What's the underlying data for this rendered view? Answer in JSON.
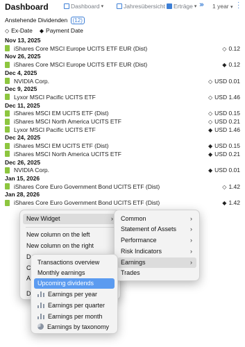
{
  "header": {
    "title": "Dashboard",
    "crumbs": [
      "Dashboard",
      "Jahresübersicht",
      "Erträge"
    ],
    "period": "1 year"
  },
  "section": {
    "title": "Anstehende Dividenden",
    "count": "(12)"
  },
  "legend": {
    "ex_date": "Ex-Date",
    "payment_date": "Payment Date",
    "ex_symbol": "◇",
    "pay_symbol": "◆"
  },
  "dividends": [
    {
      "date": "Nov 13, 2025",
      "items": [
        {
          "name": "iShares Core MSCI Europe UCITS ETF EUR (Dist)",
          "marker": "◇",
          "amount": "0.12"
        }
      ]
    },
    {
      "date": "Nov 26, 2025",
      "items": [
        {
          "name": "iShares Core MSCI Europe UCITS ETF EUR (Dist)",
          "marker": "◆",
          "amount": "0.12"
        }
      ]
    },
    {
      "date": "Dec 4, 2025",
      "items": [
        {
          "name": "NVIDIA Corp.",
          "marker": "◇",
          "amount": "USD 0.01"
        }
      ]
    },
    {
      "date": "Dec 9, 2025",
      "items": [
        {
          "name": "Lyxor MSCI Pacific UCITS ETF",
          "marker": "◇",
          "amount": "USD 1.46"
        }
      ]
    },
    {
      "date": "Dec 11, 2025",
      "items": [
        {
          "name": "iShares MSCI EM UCITS ETF (Dist)",
          "marker": "◇",
          "amount": "USD 0.15"
        },
        {
          "name": "iShares MSCI North America UCITS ETF",
          "marker": "◇",
          "amount": "USD 0.21"
        },
        {
          "name": "Lyxor MSCI Pacific UCITS ETF",
          "marker": "◆",
          "amount": "USD 1.46"
        }
      ]
    },
    {
      "date": "Dec 24, 2025",
      "items": [
        {
          "name": "iShares MSCI EM UCITS ETF (Dist)",
          "marker": "◆",
          "amount": "USD 0.15"
        },
        {
          "name": "iShares MSCI North America UCITS ETF",
          "marker": "◆",
          "amount": "USD 0.21"
        }
      ]
    },
    {
      "date": "Dec 26, 2025",
      "items": [
        {
          "name": "NVIDIA Corp.",
          "marker": "◆",
          "amount": "USD 0.01"
        }
      ]
    },
    {
      "date": "Jan 15, 2026",
      "items": [
        {
          "name": "iShares Core Euro Government Bond UCITS ETF (Dist)",
          "marker": "◇",
          "amount": "1.42"
        }
      ]
    },
    {
      "date": "Jan 28, 2026",
      "items": [
        {
          "name": "iShares Core Euro Government Bond UCITS ETF (Dist)",
          "marker": "◆",
          "amount": "1.42"
        }
      ]
    }
  ],
  "context_menu": {
    "new_widget": "New Widget",
    "new_col_left": "New column on the left",
    "new_col_right": "New column on the right",
    "partial": [
      "D",
      "C",
      "A",
      "D"
    ]
  },
  "widget_menu": [
    "Common",
    "Statement of Assets",
    "Performance",
    "Risk Indicators",
    "Earnings",
    "Trades"
  ],
  "earnings_menu": [
    {
      "label": "Transactions overview",
      "icon": "none"
    },
    {
      "label": "Monthly earnings",
      "icon": "none"
    },
    {
      "label": "Upcoming dividends",
      "icon": "none"
    },
    {
      "label": "Earnings per year",
      "icon": "bar-chart-icon"
    },
    {
      "label": "Earnings per quarter",
      "icon": "bar-chart-icon"
    },
    {
      "label": "Earnings per month",
      "icon": "bar-chart-icon"
    },
    {
      "label": "Earnings by taxonomy",
      "icon": "pie-chart-icon"
    }
  ],
  "colors": {
    "accent": "#3d7fd6",
    "doc_green": "#8dc63f",
    "selection": "#5b9bf0"
  }
}
